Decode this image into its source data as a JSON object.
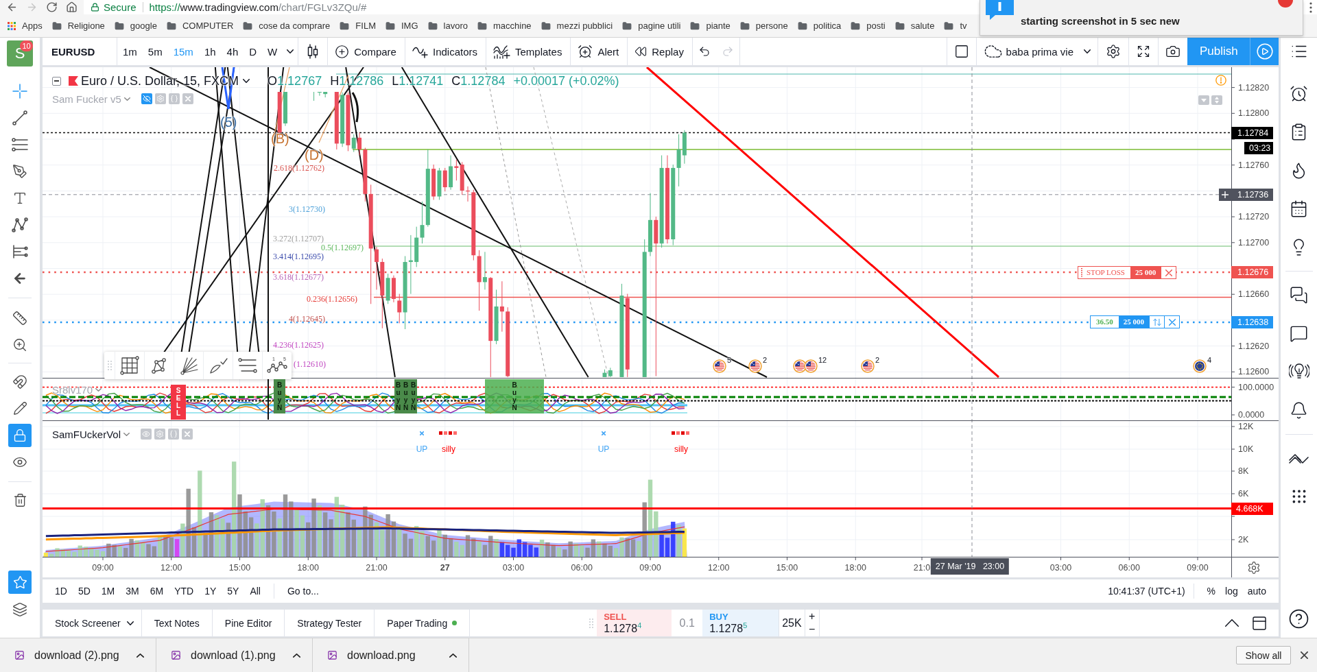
{
  "browser": {
    "nav": [
      {
        "kind": "back",
        "disabled": false
      },
      {
        "kind": "forward",
        "disabled": true
      },
      {
        "kind": "reload",
        "disabled": false
      },
      {
        "kind": "home",
        "disabled": false
      }
    ],
    "security": "Secure",
    "url": {
      "scheme": "https://",
      "host": "www.tradingview.com",
      "path": "/chart/FGLv3ZQu/#"
    }
  },
  "bookmarks": {
    "apps": "Apps",
    "folders": [
      "Religione",
      "google",
      "COMPUTER",
      "cose da comprare",
      "FILM",
      "IMG",
      "lavoro",
      "macchine",
      "mezzi pubblici",
      "pagine utili",
      "piante",
      "persone",
      "politica",
      "posti",
      "salute",
      "tv"
    ]
  },
  "notification": {
    "text": "starting screenshot in 5 sec new"
  },
  "header": {
    "avatar": {
      "letter": "S",
      "badge": "10"
    },
    "symbol": "EURUSD",
    "intervals": [
      {
        "label": "1m",
        "selected": false
      },
      {
        "label": "5m",
        "selected": false
      },
      {
        "label": "15m",
        "selected": true
      },
      {
        "label": "1h",
        "selected": false
      },
      {
        "label": "4h",
        "selected": false
      },
      {
        "label": "D",
        "selected": false
      },
      {
        "label": "W",
        "selected": false
      }
    ],
    "tools": [
      {
        "kind": "compare",
        "label": "Compare"
      },
      {
        "kind": "indicators",
        "label": "Indicators"
      },
      {
        "kind": "templates",
        "label": "Templates"
      },
      {
        "kind": "alert",
        "label": "Alert"
      },
      {
        "kind": "replay",
        "label": "Replay"
      }
    ],
    "undo": {
      "disabled": false
    },
    "redo": {
      "disabled": true
    },
    "layout": "baba prima vie",
    "publish": "Publish"
  },
  "left_toolbar": {
    "tools": [
      {
        "kind": "crosshair",
        "selected": true
      },
      {
        "kind": "trend_line",
        "selected": false
      },
      {
        "kind": "fib",
        "selected": false
      },
      {
        "kind": "brush",
        "selected": false
      },
      {
        "kind": "text",
        "selected": false
      },
      {
        "kind": "pattern",
        "selected": false
      },
      {
        "kind": "forecast",
        "selected": false
      },
      {
        "kind": "arrow",
        "selected": false
      }
    ],
    "toggles": [
      {
        "kind": "magnet",
        "on": false
      },
      {
        "kind": "stay_drawing",
        "on": false
      },
      {
        "kind": "lock",
        "on": true
      },
      {
        "kind": "visibility",
        "on": false
      }
    ],
    "favorites": {
      "on": true
    }
  },
  "chart": {
    "legend": {
      "title": "Euro / U.S. Dollar, 15, FXCM",
      "ohlc": [
        {
          "label": "O",
          "value": "1.12767"
        },
        {
          "label": "H",
          "value": "1.12786"
        },
        {
          "label": "L",
          "value": "1.12741"
        },
        {
          "label": "C",
          "value": "1.12784"
        }
      ],
      "change": "+0.00017 (+0.02%)"
    },
    "indicator": {
      "name": "Sam Fucker v5",
      "hidden": true
    },
    "fib_labels": [
      {
        "text": "2.618(1.12762)",
        "color": "#d9534f"
      },
      {
        "text": "3(1.12730)",
        "color": "#4a9fd8"
      },
      {
        "text": "3.272(1.12707)",
        "color": "#9e9e9e"
      },
      {
        "text": "0.5(1.12697)",
        "color": "#5cb85c"
      },
      {
        "text": "3.414(1.12695)",
        "color": "#3949ab"
      },
      {
        "text": "3.618(1.12677)",
        "color": "#b565b8"
      },
      {
        "text": "0.236(1.12656)",
        "color": "#e53935"
      },
      {
        "text": "4(1.12645)",
        "color": "#c0504d"
      },
      {
        "text": "4.236(1.12625)",
        "color": "#c045c0"
      },
      {
        "text": "(1.12610)",
        "color": "#c045c0"
      }
    ],
    "wave_labels": [
      {
        "text": "(5)",
        "color": "#3b6ea5"
      },
      {
        "text": "(B)",
        "color": "#c87533"
      },
      {
        "text": "(D)",
        "color": "#c87533"
      }
    ],
    "price_axis": [
      {
        "text": "1.12820",
        "kind": "tick"
      },
      {
        "text": "1.12800",
        "kind": "tick"
      },
      {
        "text": "1.12784",
        "kind": "tag",
        "color": "#000000"
      },
      {
        "text": "03:23",
        "kind": "countdown",
        "color": "#000000"
      },
      {
        "text": "1.12760",
        "kind": "tick"
      },
      {
        "text": "1.12736",
        "kind": "crosshair"
      },
      {
        "text": "1.12720",
        "kind": "tick"
      },
      {
        "text": "1.12700",
        "kind": "tick"
      },
      {
        "text": "1.12676",
        "kind": "tag",
        "color": "#ef5350"
      },
      {
        "text": "1.12660",
        "kind": "tick"
      },
      {
        "text": "1.12638",
        "kind": "tag",
        "color": "#2196f3"
      },
      {
        "text": "1.12620",
        "kind": "tick"
      },
      {
        "text": "1.12600",
        "kind": "tick"
      }
    ],
    "orders": [
      {
        "kind": "stop",
        "label": "STOP LOSS",
        "quantity": "25 000"
      },
      {
        "kind": "position",
        "pnl": "36.50",
        "quantity": "25 000"
      }
    ],
    "events": [
      {
        "kind": "us",
        "count": "5"
      },
      {
        "kind": "us",
        "count": "2"
      },
      {
        "kind": "us_pair",
        "count": "12"
      },
      {
        "kind": "us",
        "count": "2"
      },
      {
        "kind": "eu",
        "count": "4"
      }
    ],
    "drawing_toolbar": {
      "wave_marks": [
        "1",
        "5"
      ]
    },
    "oscillator": {
      "name": "Sr8lv170",
      "signals": [
        {
          "kind": "sell",
          "text": "SELL"
        },
        {
          "kind": "buy",
          "text": "BuyN"
        },
        {
          "kind": "buy",
          "text": "BuyN"
        },
        {
          "kind": "buy",
          "text": "BuyN"
        },
        {
          "kind": "buy",
          "text": "BuyN"
        },
        {
          "kind": "buy",
          "text": "BuyN"
        }
      ],
      "axis": [
        "100.0000",
        "0.0000"
      ]
    },
    "volume": {
      "name": "SamFUckerVol",
      "labels": [
        {
          "kind": "up",
          "text": "UP"
        },
        {
          "kind": "down",
          "text": "silly"
        },
        {
          "kind": "up",
          "text": "UP"
        },
        {
          "kind": "down",
          "text": "silly"
        }
      ],
      "axis": [
        {
          "text": "12K",
          "kind": "tick"
        },
        {
          "text": "10K",
          "kind": "tick"
        },
        {
          "text": "8K",
          "kind": "tick"
        },
        {
          "text": "6K",
          "kind": "tick"
        },
        {
          "text": "4.668K",
          "kind": "tag",
          "color": "#ff0000"
        },
        {
          "text": "2K",
          "kind": "tick"
        }
      ]
    },
    "time_axis": [
      {
        "text": "09:00",
        "kind": "time"
      },
      {
        "text": "12:00",
        "kind": "time"
      },
      {
        "text": "15:00",
        "kind": "time"
      },
      {
        "text": "18:00",
        "kind": "time"
      },
      {
        "text": "21:00",
        "kind": "time"
      },
      {
        "text": "27",
        "kind": "day"
      },
      {
        "text": "03:00",
        "kind": "time"
      },
      {
        "text": "06:00",
        "kind": "time"
      },
      {
        "text": "09:00",
        "kind": "time"
      },
      {
        "text": "12:00",
        "kind": "time"
      },
      {
        "text": "15:00",
        "kind": "time"
      },
      {
        "text": "18:00",
        "kind": "time"
      },
      {
        "text": "21:0",
        "kind": "time"
      },
      {
        "text": "27 Mar '19   23:00",
        "kind": "cursor"
      },
      {
        "text": "03:00",
        "kind": "time"
      },
      {
        "text": "06:00",
        "kind": "time"
      },
      {
        "text": "09:00",
        "kind": "time"
      }
    ]
  },
  "range_bar": {
    "ranges": [
      "1D",
      "5D",
      "1M",
      "3M",
      "6M",
      "YTD",
      "1Y",
      "5Y",
      "All"
    ],
    "goto": "Go to...",
    "clock": "10:41:37 (UTC+1)",
    "scale": [
      {
        "label": "%",
        "selected": false
      },
      {
        "label": "log",
        "selected": false
      },
      {
        "label": "auto",
        "selected": false
      }
    ]
  },
  "bottom_panel": {
    "tabs": [
      {
        "label": "Stock Screener",
        "has_menu": true,
        "connected": false
      },
      {
        "label": "Text Notes",
        "has_menu": false,
        "connected": false
      },
      {
        "label": "Pine Editor",
        "has_menu": false,
        "connected": false
      },
      {
        "label": "Strategy Tester",
        "has_menu": false,
        "connected": false
      },
      {
        "label": "Paper Trading",
        "has_menu": false,
        "connected": true
      }
    ],
    "trade": {
      "sell": {
        "label": "SELL",
        "price": "1.1278$^{4}$"
      },
      "spread": "0.1",
      "buy": {
        "label": "BUY",
        "price": "1.1278$^{5}$"
      },
      "quantity": "25K",
      "plus": "+",
      "minus": "−"
    }
  },
  "downloads": {
    "files": [
      "download (2).png",
      "download (1).png",
      "download.png"
    ],
    "show_all": "Show all"
  }
}
